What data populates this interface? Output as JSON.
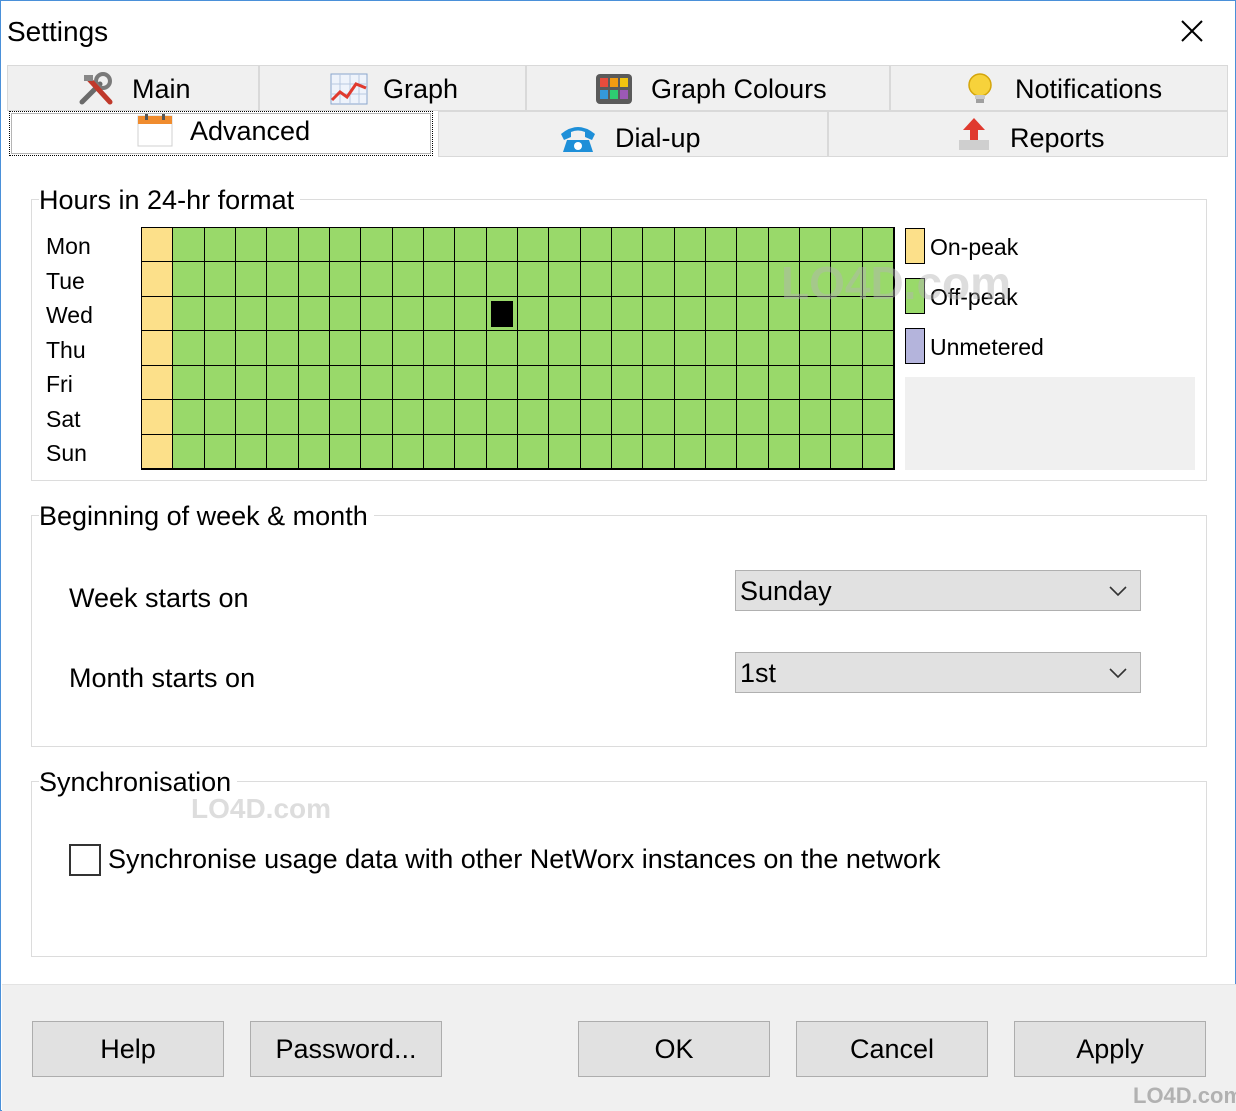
{
  "window": {
    "title": "Settings",
    "close_glyph": "✕"
  },
  "tabs_top": [
    {
      "label": "Main",
      "icon": "tools-icon"
    },
    {
      "label": "Graph",
      "icon": "graph-icon"
    },
    {
      "label": "Graph Colours",
      "icon": "palette-icon"
    },
    {
      "label": "Notifications",
      "icon": "lightbulb-icon"
    }
  ],
  "tabs_bottom": [
    {
      "label": "Advanced",
      "icon": "calendar-icon",
      "active": true
    },
    {
      "label": "Dial-up",
      "icon": "telephone-icon"
    },
    {
      "label": "Reports",
      "icon": "upload-arrow-icon"
    }
  ],
  "hours": {
    "title": "Hours in 24-hr format",
    "days": [
      "Mon",
      "Tue",
      "Wed",
      "Thu",
      "Fri",
      "Sat",
      "Sun"
    ],
    "hours_count": 24,
    "on_peak_hours": [
      0
    ],
    "legend": [
      {
        "label": "On-peak",
        "color": "#fce08a"
      },
      {
        "label": "Off-peak",
        "color": "#99d96a"
      },
      {
        "label": "Unmetered",
        "color": "#b4b4dc"
      }
    ]
  },
  "week_month": {
    "title": "Beginning of week & month",
    "week_label": "Week starts on",
    "week_value": "Sunday",
    "month_label": "Month starts on",
    "month_value": "1st"
  },
  "sync": {
    "title": "Synchronisation",
    "checkbox_label": "Synchronise usage data with other NetWorx instances on the network",
    "checked": false
  },
  "buttons": {
    "help": "Help",
    "password": "Password...",
    "ok": "OK",
    "cancel": "Cancel",
    "apply": "Apply"
  },
  "watermark": "LO4D.com"
}
